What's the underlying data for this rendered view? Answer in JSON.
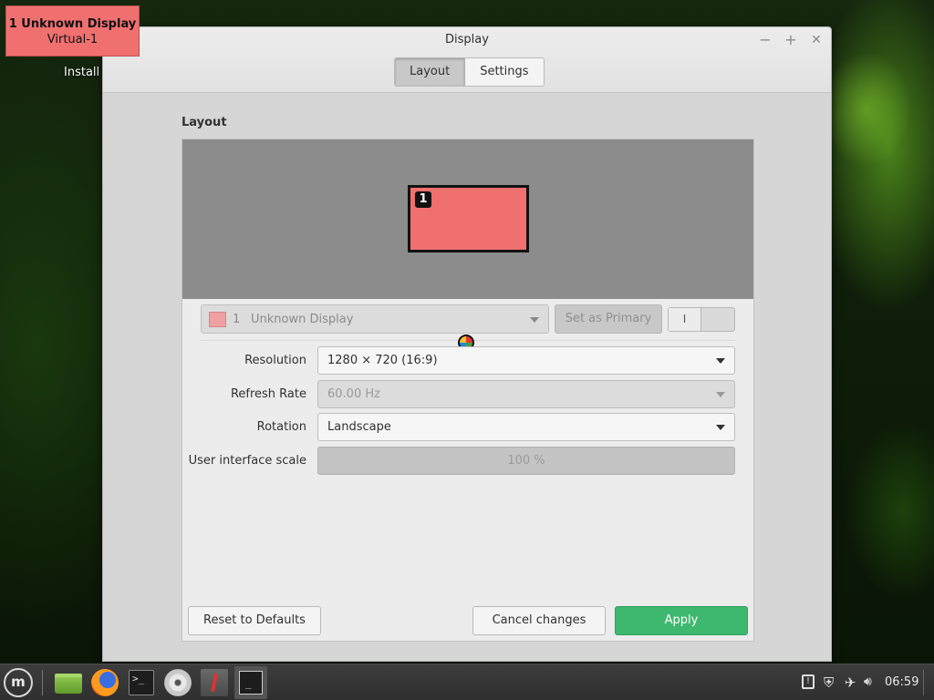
{
  "desktop": {
    "install_label": "Install"
  },
  "identify": {
    "line1": "1  Unknown Display",
    "line2": "Virtual-1"
  },
  "window": {
    "title": "Display",
    "controls": {
      "minimize": "−",
      "maximize": "+",
      "close": "✕"
    },
    "tabs": [
      {
        "label": "Layout",
        "active": true
      },
      {
        "label": "Settings",
        "active": false
      }
    ]
  },
  "layout": {
    "section_title": "Layout",
    "monitor_number": "1",
    "display_select": {
      "number": "1",
      "name": "Unknown Display",
      "swatch_color": "#f0a0a0"
    },
    "set_primary_label": "Set as Primary",
    "toggle_label": "I",
    "resolution": {
      "label": "Resolution",
      "value": "1280 × 720 (16:9)"
    },
    "refresh_rate": {
      "label": "Refresh Rate",
      "value": "60.00 Hz"
    },
    "rotation": {
      "label": "Rotation",
      "value": "Landscape"
    },
    "ui_scale": {
      "label": "User interface scale",
      "value": "100 %"
    }
  },
  "buttons": {
    "reset": "Reset to Defaults",
    "cancel": "Cancel changes",
    "apply": "Apply"
  },
  "colors": {
    "monitor": "#f07070",
    "apply": "#3fb86f",
    "preview_bg": "#8c8c8c"
  },
  "taskbar": {
    "menu_icon": "mint-menu-icon",
    "launchers": [
      "files-icon",
      "firefox-icon",
      "terminal-icon",
      "disc-icon",
      "xapp-icon"
    ],
    "active_window_icon": "terminal-icon",
    "tray_icons": [
      "notifications-icon",
      "update-shield-icon",
      "network-icon",
      "volume-icon"
    ],
    "clock": "06:59"
  }
}
